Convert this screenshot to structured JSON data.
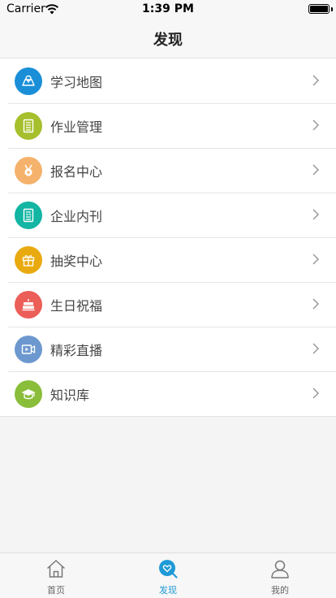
{
  "status_bar": {
    "carrier": "Carrier",
    "time": "1:39 PM"
  },
  "header": {
    "title": "发现"
  },
  "menu": [
    {
      "label": "学习地图",
      "icon": "map-icon",
      "color": "#1a8fd8"
    },
    {
      "label": "作业管理",
      "icon": "notebook-icon",
      "color": "#a6bf2d"
    },
    {
      "label": "报名中心",
      "icon": "medal-icon",
      "color": "#f4b26c"
    },
    {
      "label": "企业内刊",
      "icon": "document-icon",
      "color": "#13b5a3"
    },
    {
      "label": "抽奖中心",
      "icon": "gift-icon",
      "color": "#e9aa0f"
    },
    {
      "label": "生日祝福",
      "icon": "cake-icon",
      "color": "#ec5e58"
    },
    {
      "label": "精彩直播",
      "icon": "video-icon",
      "color": "#6d98cf"
    },
    {
      "label": "知识库",
      "icon": "graduation-cap-icon",
      "color": "#89bd3a"
    }
  ],
  "tab_bar": {
    "tabs": [
      {
        "label": "首页",
        "icon": "home-icon",
        "active": false
      },
      {
        "label": "发现",
        "icon": "discover-icon",
        "active": true
      },
      {
        "label": "我的",
        "icon": "profile-icon",
        "active": false
      }
    ],
    "active_color": "#1e9ad6"
  }
}
